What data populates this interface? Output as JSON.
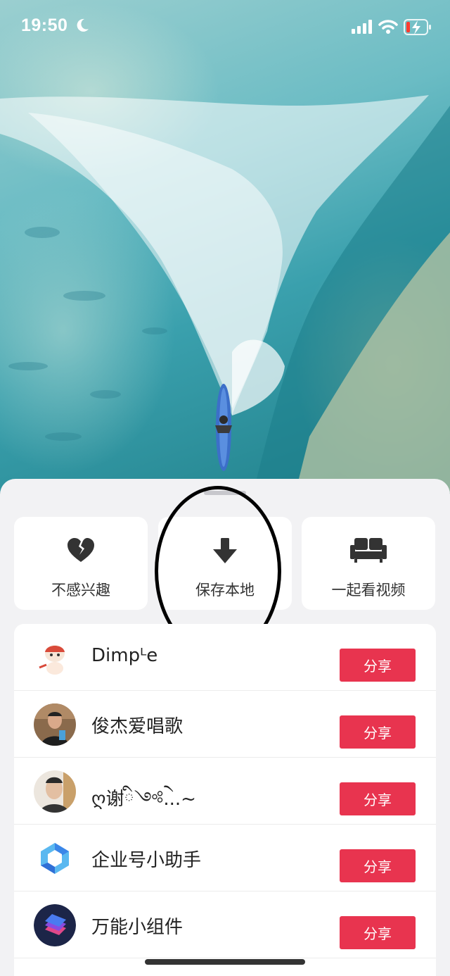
{
  "status_bar": {
    "time": "19:50"
  },
  "actions": [
    {
      "label": "不感兴趣",
      "icon": "broken-heart-icon"
    },
    {
      "label": "保存本地",
      "icon": "download-arrow-icon"
    },
    {
      "label": "一起看视频",
      "icon": "sofa-icon"
    }
  ],
  "friends": [
    {
      "name": "Dimpᴸe",
      "button": "分享"
    },
    {
      "name": "俊杰爱唱歌",
      "button": "分享"
    },
    {
      "name": "ღ谢ི༺ེ...~",
      "button": "分享"
    },
    {
      "name": "企业号小助手",
      "button": "分享"
    },
    {
      "name": "万能小组件",
      "button": "分享"
    }
  ],
  "colors": {
    "share_button": "#e8344f",
    "sheet_bg": "#f2f2f4",
    "battery_low": "#ff3b30"
  }
}
